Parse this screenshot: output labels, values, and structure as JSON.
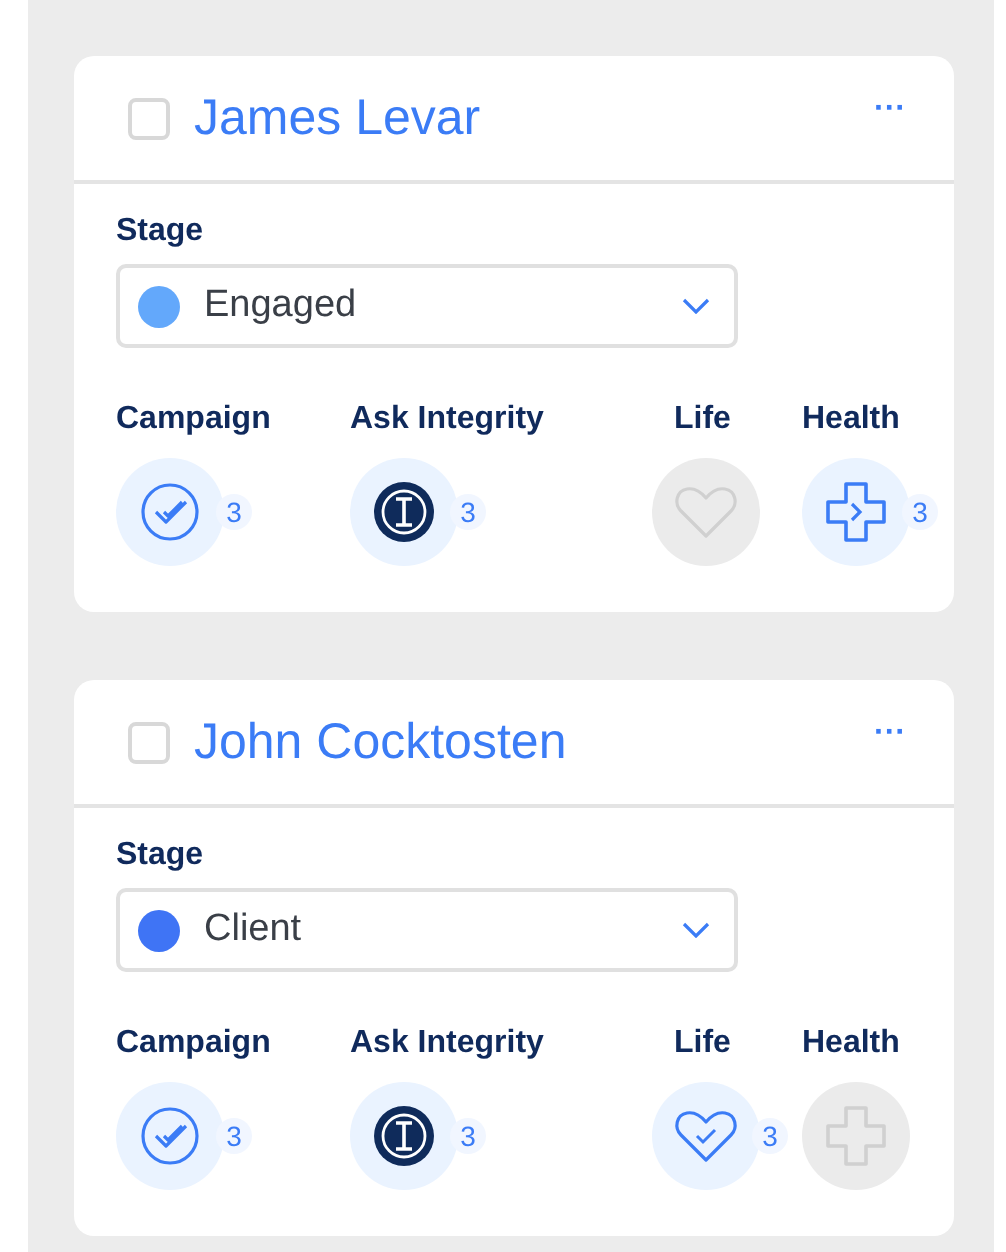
{
  "cards": [
    {
      "name": "James Levar",
      "checked": false,
      "menu": "···",
      "stage_label": "Stage",
      "stage": {
        "value": "Engaged",
        "color": "#63a8fb"
      },
      "metrics": [
        {
          "kind": "campaign",
          "label": "Campaign",
          "active": true,
          "count": "3"
        },
        {
          "kind": "integrity",
          "label": "Ask Integrity",
          "active": true,
          "count": "3"
        },
        {
          "kind": "life",
          "label": "Life",
          "active": false
        },
        {
          "kind": "health",
          "label": "Health",
          "active": true,
          "count": "3"
        }
      ]
    },
    {
      "name": "John Cocktosten",
      "checked": false,
      "menu": "···",
      "stage_label": "Stage",
      "stage": {
        "value": "Client",
        "color": "#3f74f5"
      },
      "metrics": [
        {
          "kind": "campaign",
          "label": "Campaign",
          "active": true,
          "count": "3"
        },
        {
          "kind": "integrity",
          "label": "Ask Integrity",
          "active": true,
          "count": "3"
        },
        {
          "kind": "life",
          "label": "Life",
          "active": true,
          "count": "3"
        },
        {
          "kind": "health",
          "label": "Health",
          "active": false
        }
      ]
    }
  ]
}
